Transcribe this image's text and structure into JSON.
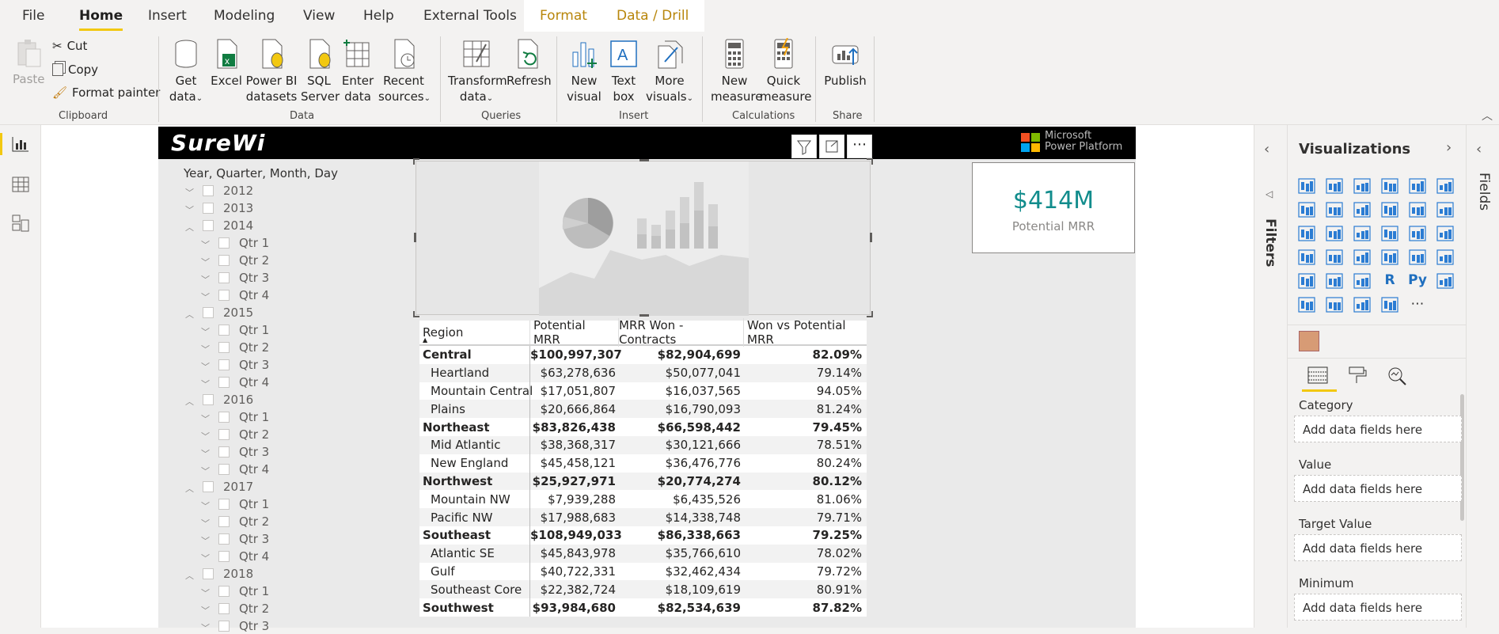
{
  "menu": {
    "tabs": [
      "File",
      "Home",
      "Insert",
      "Modeling",
      "View",
      "Help",
      "External Tools"
    ],
    "context_tabs": [
      "Format",
      "Data / Drill"
    ],
    "active_tab": "Home"
  },
  "ribbon": {
    "clipboard": {
      "paste": "Paste",
      "cut": "Cut",
      "copy": "Copy",
      "format_painter": "Format painter",
      "group": "Clipboard"
    },
    "data": {
      "get_data": [
        "Get",
        "data"
      ],
      "excel": "Excel",
      "power_bi": [
        "Power BI",
        "datasets"
      ],
      "sql": [
        "SQL",
        "Server"
      ],
      "enter": [
        "Enter",
        "data"
      ],
      "recent": [
        "Recent",
        "sources"
      ],
      "group": "Data"
    },
    "queries": {
      "transform": [
        "Transform",
        "data"
      ],
      "refresh": "Refresh",
      "group": "Queries"
    },
    "insert": {
      "new_visual": [
        "New",
        "visual"
      ],
      "text_box": [
        "Text",
        "box"
      ],
      "more_visuals": [
        "More",
        "visuals"
      ],
      "group": "Insert"
    },
    "calculations": {
      "new_measure": [
        "New",
        "measure"
      ],
      "quick_measure": [
        "Quick",
        "measure"
      ],
      "group": "Calculations"
    },
    "share": {
      "publish": "Publish",
      "group": "Share"
    }
  },
  "report": {
    "logo": "SureWi",
    "ms_logo": [
      "Microsoft",
      "Power Platform"
    ],
    "slicer_title": "Year, Quarter, Month, Day",
    "slicer_items": [
      {
        "label": "2012",
        "level": 0,
        "expanded": false
      },
      {
        "label": "2013",
        "level": 0,
        "expanded": false
      },
      {
        "label": "2014",
        "level": 0,
        "expanded": true
      },
      {
        "label": "Qtr 1",
        "level": 1
      },
      {
        "label": "Qtr 2",
        "level": 1
      },
      {
        "label": "Qtr 3",
        "level": 1
      },
      {
        "label": "Qtr 4",
        "level": 1
      },
      {
        "label": "2015",
        "level": 0,
        "expanded": true
      },
      {
        "label": "Qtr 1",
        "level": 1
      },
      {
        "label": "Qtr 2",
        "level": 1
      },
      {
        "label": "Qtr 3",
        "level": 1
      },
      {
        "label": "Qtr 4",
        "level": 1
      },
      {
        "label": "2016",
        "level": 0,
        "expanded": true
      },
      {
        "label": "Qtr 1",
        "level": 1
      },
      {
        "label": "Qtr 2",
        "level": 1
      },
      {
        "label": "Qtr 3",
        "level": 1
      },
      {
        "label": "Qtr 4",
        "level": 1
      },
      {
        "label": "2017",
        "level": 0,
        "expanded": true
      },
      {
        "label": "Qtr 1",
        "level": 1
      },
      {
        "label": "Qtr 2",
        "level": 1
      },
      {
        "label": "Qtr 3",
        "level": 1
      },
      {
        "label": "Qtr 4",
        "level": 1
      },
      {
        "label": "2018",
        "level": 0,
        "expanded": true
      },
      {
        "label": "Qtr 1",
        "level": 1
      },
      {
        "label": "Qtr 2",
        "level": 1
      },
      {
        "label": "Qtr 3",
        "level": 1
      }
    ],
    "card": {
      "value": "$414M",
      "label": "Potential MRR"
    },
    "table": {
      "headers": [
        "Region",
        "Potential MRR",
        "MRR Won - Contracts",
        "Won vs Potential MRR"
      ],
      "rows": [
        {
          "region": "Central",
          "potential": "$100,997,307",
          "won": "$82,904,699",
          "pct": "82.09%",
          "bold": true
        },
        {
          "region": "Heartland",
          "potential": "$63,278,636",
          "won": "$50,077,041",
          "pct": "79.14%"
        },
        {
          "region": "Mountain Central",
          "potential": "$17,051,807",
          "won": "$16,037,565",
          "pct": "94.05%"
        },
        {
          "region": "Plains",
          "potential": "$20,666,864",
          "won": "$16,790,093",
          "pct": "81.24%"
        },
        {
          "region": "Northeast",
          "potential": "$83,826,438",
          "won": "$66,598,442",
          "pct": "79.45%",
          "bold": true
        },
        {
          "region": "Mid Atlantic",
          "potential": "$38,368,317",
          "won": "$30,121,666",
          "pct": "78.51%"
        },
        {
          "region": "New England",
          "potential": "$45,458,121",
          "won": "$36,476,776",
          "pct": "80.24%"
        },
        {
          "region": "Northwest",
          "potential": "$25,927,971",
          "won": "$20,774,274",
          "pct": "80.12%",
          "bold": true
        },
        {
          "region": "Mountain NW",
          "potential": "$7,939,288",
          "won": "$6,435,526",
          "pct": "81.06%"
        },
        {
          "region": "Pacific NW",
          "potential": "$17,988,683",
          "won": "$14,338,748",
          "pct": "79.71%"
        },
        {
          "region": "Southeast",
          "potential": "$108,949,033",
          "won": "$86,338,663",
          "pct": "79.25%",
          "bold": true
        },
        {
          "region": "Atlantic SE",
          "potential": "$45,843,978",
          "won": "$35,766,610",
          "pct": "78.02%"
        },
        {
          "region": "Gulf",
          "potential": "$40,722,331",
          "won": "$32,462,434",
          "pct": "79.72%"
        },
        {
          "region": "Southeast Core",
          "potential": "$22,382,724",
          "won": "$18,109,619",
          "pct": "80.91%"
        },
        {
          "region": "Southwest",
          "potential": "$93,984,680",
          "won": "$82,534,639",
          "pct": "87.82%",
          "bold": true
        }
      ]
    }
  },
  "panes": {
    "filters": "Filters",
    "visualizations": "Visualizations",
    "fields": "Fields",
    "wells": [
      "Category",
      "Value",
      "Target Value",
      "Minimum"
    ],
    "well_placeholder": "Add data fields here"
  }
}
